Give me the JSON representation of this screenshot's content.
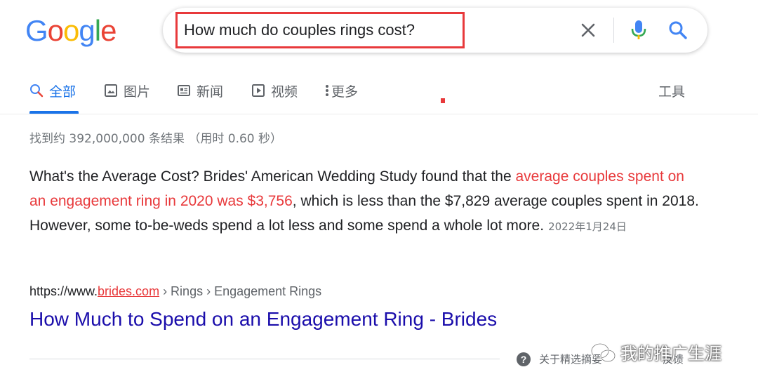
{
  "logo": {
    "letters": [
      "G",
      "o",
      "o",
      "g",
      "l",
      "e"
    ]
  },
  "colors": {
    "blue": "#4285f4",
    "red": "#ea4335",
    "yellow": "#fbbc05",
    "green": "#34a853",
    "highlight_red": "#e8393b",
    "link_blue": "#1a0dab",
    "active_tab": "#1a73e8"
  },
  "search": {
    "query": "How much do couples rings cost?",
    "clear_icon": "close-icon",
    "voice_icon": "microphone-icon",
    "search_icon": "search-icon"
  },
  "tabs": [
    {
      "label": "全部",
      "icon": "search-icon",
      "active": true
    },
    {
      "label": "图片",
      "icon": "image-icon",
      "active": false
    },
    {
      "label": "新闻",
      "icon": "news-icon",
      "active": false
    },
    {
      "label": "视频",
      "icon": "play-icon",
      "active": false
    },
    {
      "label": "更多",
      "icon": "more-vert-icon",
      "active": false
    },
    {
      "label": "工具",
      "icon": "",
      "active": false
    }
  ],
  "stats": "找到约 392,000,000 条结果 （用时 0.60 秒）",
  "featured_snippet": {
    "text_before": "What's the Average Cost? Brides' American Wedding Study found that the ",
    "highlight": "average couples spent on an engagement ring in 2020 was $3,756",
    "text_after": ", which is less than the $7,829 average couples spent in 2018. However, some to-be-weds spend a lot less and some spend a whole lot more.",
    "date": "2022年1月24日"
  },
  "result": {
    "url_prefix": "https://www.",
    "domain": "brides.com",
    "breadcrumb": " › Rings › Engagement Rings",
    "title": "How Much to Spend on an Engagement Ring - Brides"
  },
  "footer": {
    "about": "关于精选摘要",
    "feedback": "反馈",
    "help_icon_glyph": "?"
  },
  "watermark": {
    "text": "我的推广生涯"
  }
}
